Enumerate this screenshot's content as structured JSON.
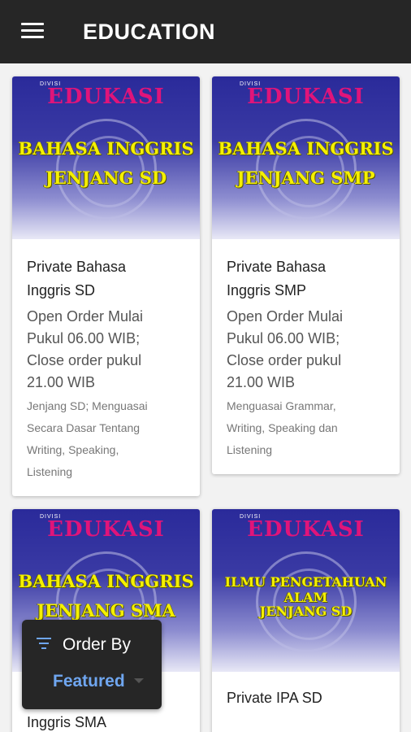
{
  "header": {
    "title": "EDUCATION",
    "menu_icon": "hamburger-menu-icon"
  },
  "cards": [
    {
      "banner": {
        "divisi": "DIVISI",
        "edukasi": "EDUKASI",
        "line1": "BAHASA INGGRIS",
        "line2": "JENJANG SD"
      },
      "title_line1": "Private Bahasa",
      "title_line2": "Inggris SD",
      "subtitle": [
        "Open Order Mulai",
        "Pukul 06.00 WIB;",
        "Close order pukul",
        "21.00 WIB"
      ],
      "description": [
        "Jenjang SD; Menguasai",
        "Secara Dasar Tentang",
        "Writing, Speaking,",
        "Listening"
      ]
    },
    {
      "banner": {
        "divisi": "DIVISI",
        "edukasi": "EDUKASI",
        "line1": "BAHASA INGGRIS",
        "line2": "JENJANG SMP"
      },
      "title_line1": "Private Bahasa",
      "title_line2": "Inggris SMP",
      "subtitle": [
        "Open Order Mulai",
        "Pukul 06.00 WIB;",
        "Close order pukul",
        "21.00 WIB"
      ],
      "description": [
        "Menguasai Grammar,",
        "Writing, Speaking dan",
        "Listening"
      ]
    },
    {
      "banner": {
        "divisi": "DIVISI",
        "edukasi": "EDUKASI",
        "line1": "BAHASA INGGRIS",
        "line2": "JENJANG SMA"
      },
      "title_line2": "Inggris SMA"
    },
    {
      "banner": {
        "divisi": "DIVISI",
        "edukasi": "EDUKASI",
        "line1": "ILMU PENGETAHUAN ALAM",
        "line2": "JENJANG SD"
      },
      "title_line1": "Private IPA SD"
    }
  ],
  "order_by": {
    "label": "Order By",
    "value": "Featured",
    "icon": "sort-icon"
  },
  "colors": {
    "appbar": "#262626",
    "accent": "#6fa6f0",
    "banner_magenta": "#e0147a",
    "banner_yellow": "#f5f000"
  }
}
